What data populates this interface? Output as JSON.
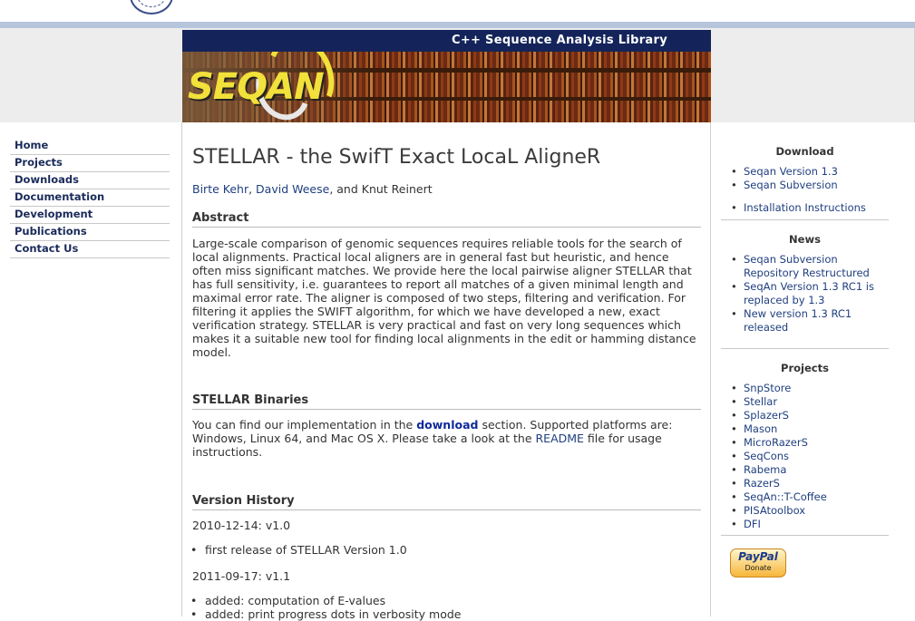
{
  "banner": {
    "tagline": "C++ Sequence Analysis Library",
    "logo_text": "SEQAN"
  },
  "nav": [
    "Home",
    "Projects",
    "Downloads",
    "Documentation",
    "Development",
    "Publications",
    "Contact Us"
  ],
  "main": {
    "title": "STELLAR - the SwifT Exact LocaL AligneR",
    "authors": {
      "author1": "Birte Kehr",
      "sep1": ", ",
      "author2": "David Weese",
      "sep2": ", and Knut Reinert"
    },
    "abstract_heading": "Abstract",
    "abstract_text": "Large-scale comparison of genomic sequences requires reliable tools for the search of local alignments. Practical local aligners are in general fast but heuristic, and hence often miss significant matches. We provide here the local pairwise aligner STELLAR that has full sensitivity, i.e. guarantees to report all matches of a given minimal length and maximal error rate. The aligner is composed of two steps, filtering and verification. For filtering it applies the SWIFT algorithm, for which we have developed a new, exact verification strategy. STELLAR is very practical and fast on very long sequences which makes it a suitable new tool for finding local alignments in the edit or hamming distance model.",
    "binaries_heading": "STELLAR Binaries",
    "binaries": {
      "pre": "You can find our implementation in the ",
      "download_link": "download",
      "mid": " section. Supported platforms are: Windows, Linux 64, and Mac OS X. Please take a look at the ",
      "readme_link": "README",
      "post": " file for usage instructions."
    },
    "history_heading": "Version History",
    "v1_date": "2010-12-14: v1.0",
    "v1_item": "first release of STELLAR Version 1.0",
    "v2_date": "2011-09-17: v1.1",
    "v2_items": [
      "added: computation of E-values",
      "added: print progress dots in verbosity mode"
    ]
  },
  "right": {
    "download_heading": "Download",
    "download_items": [
      "Seqan Version 1.3",
      "Seqan Subversion"
    ],
    "install_link": "Installation Instructions",
    "news_heading": "News",
    "news_items": [
      "Seqan Subversion Repository Restructured",
      "SeqAn Version 1.3 RC1 is replaced by 1.3",
      "New version 1.3 RC1 released"
    ],
    "projects_heading": "Projects",
    "project_items": [
      "SnpStore",
      "Stellar",
      "SplazerS",
      "Mason",
      "MicroRazerS",
      "SeqCons",
      "Rabema",
      "RazerS",
      "SeqAn::T-Coffee",
      "PISAtoolbox",
      "DFI"
    ],
    "paypal_logo": "PayPal",
    "paypal_label": "Donate"
  }
}
